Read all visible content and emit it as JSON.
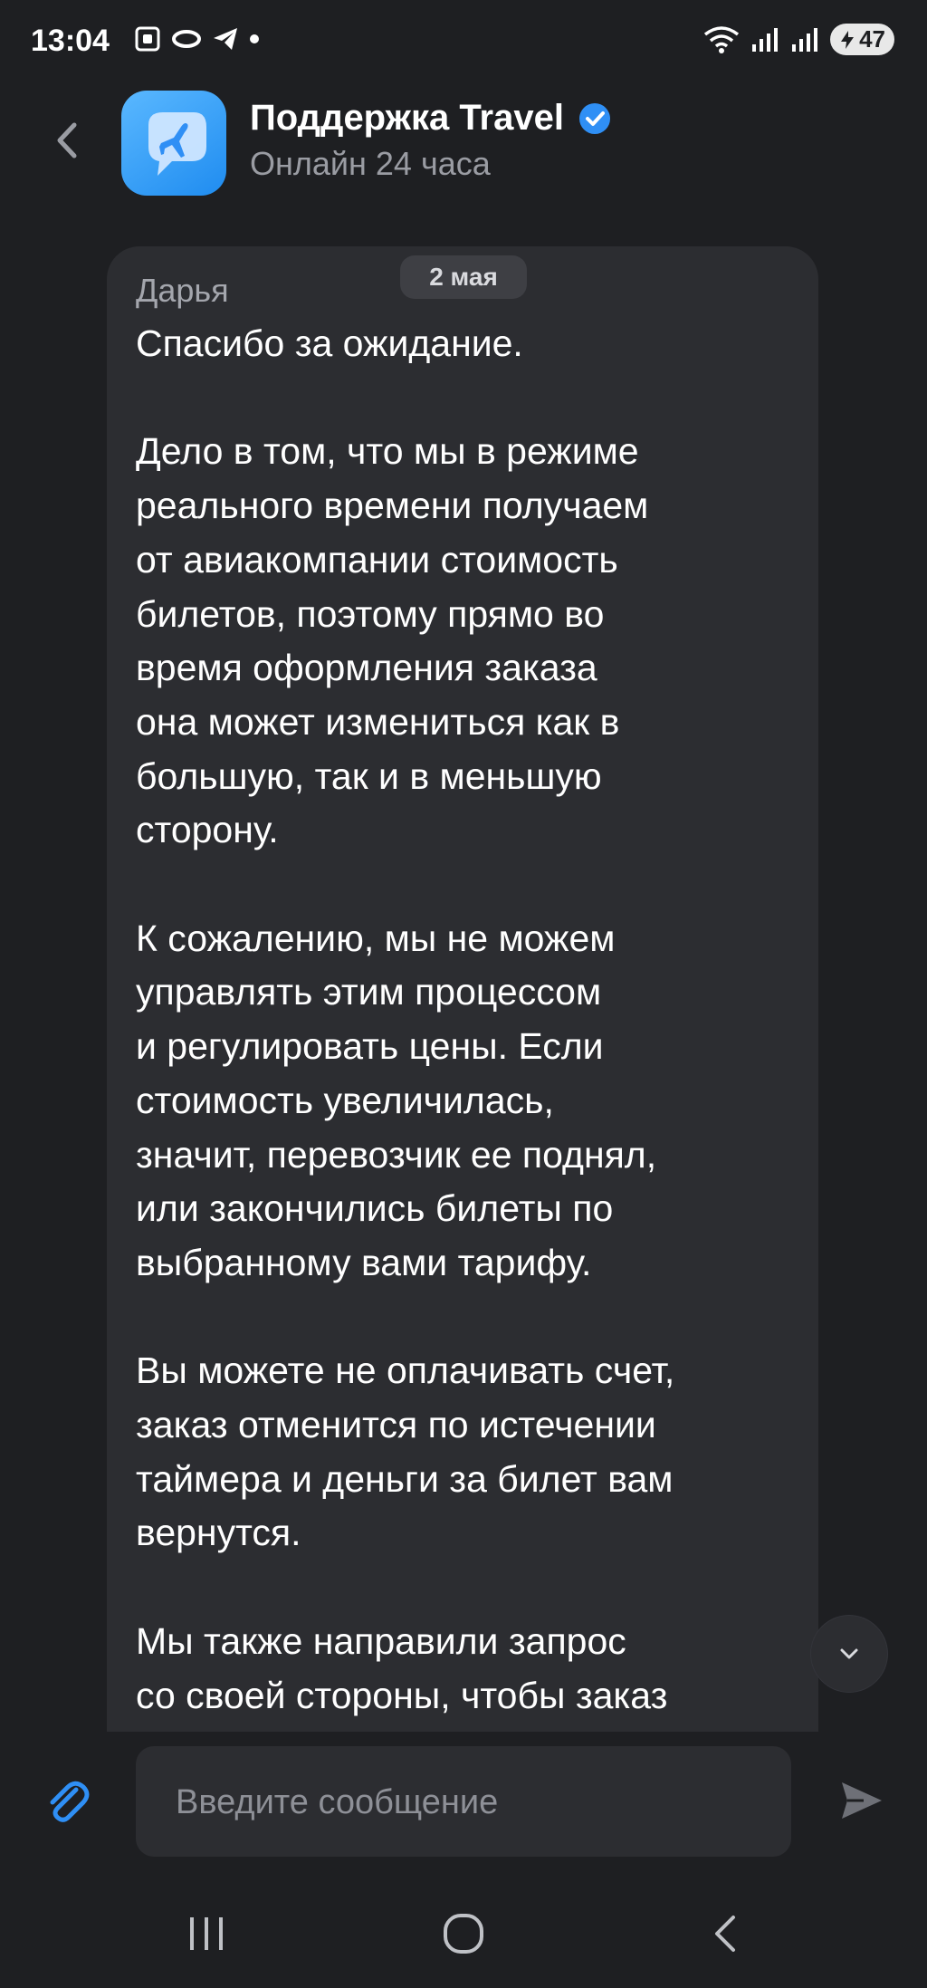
{
  "status_bar": {
    "time": "13:04",
    "battery": "47",
    "icons": [
      "screenshot-icon",
      "link-icon",
      "telegram-icon",
      "dot-icon",
      "wifi-icon",
      "signal-icon",
      "signal-icon"
    ]
  },
  "header": {
    "title": "Поддержка Travel",
    "subtitle": "Онлайн 24 часа",
    "avatar_icon": "airplane-chat-icon",
    "verified_icon": "verified-badge-icon",
    "accent_color": "#2f8ff5"
  },
  "chat": {
    "date_label": "2 мая",
    "messages": [
      {
        "sender": "Дарья",
        "text": "Спасибо за ожидание.\n\nДело в том, что мы в режиме\nреального времени получаем\nот авиакомпании стоимость\nбилетов, поэтому прямо во\nвремя оформления заказа\nона может измениться как в\nбольшую, так и в меньшую\nсторону.\n\nК сожалению, мы не можем\nуправлять этим процессом\nи регулировать цены. Если\nстоимость увеличилась,\nзначит, перевозчик ее поднял,\nили закончились билеты по\nвыбранному вами тарифу.\n\nВы можете не оплачивать счет,\nзаказ отменится по истечении\nтаймера и деньги за билет вам\nвернутся.\n\nМы также направили запрос\nсо своей стороны, чтобы заказ"
      }
    ]
  },
  "composer": {
    "placeholder": "Введите сообщение",
    "value": ""
  },
  "colors": {
    "background": "#1e1f22",
    "bubble": "#2c2d31",
    "secondary_text": "#9a9ca3"
  }
}
